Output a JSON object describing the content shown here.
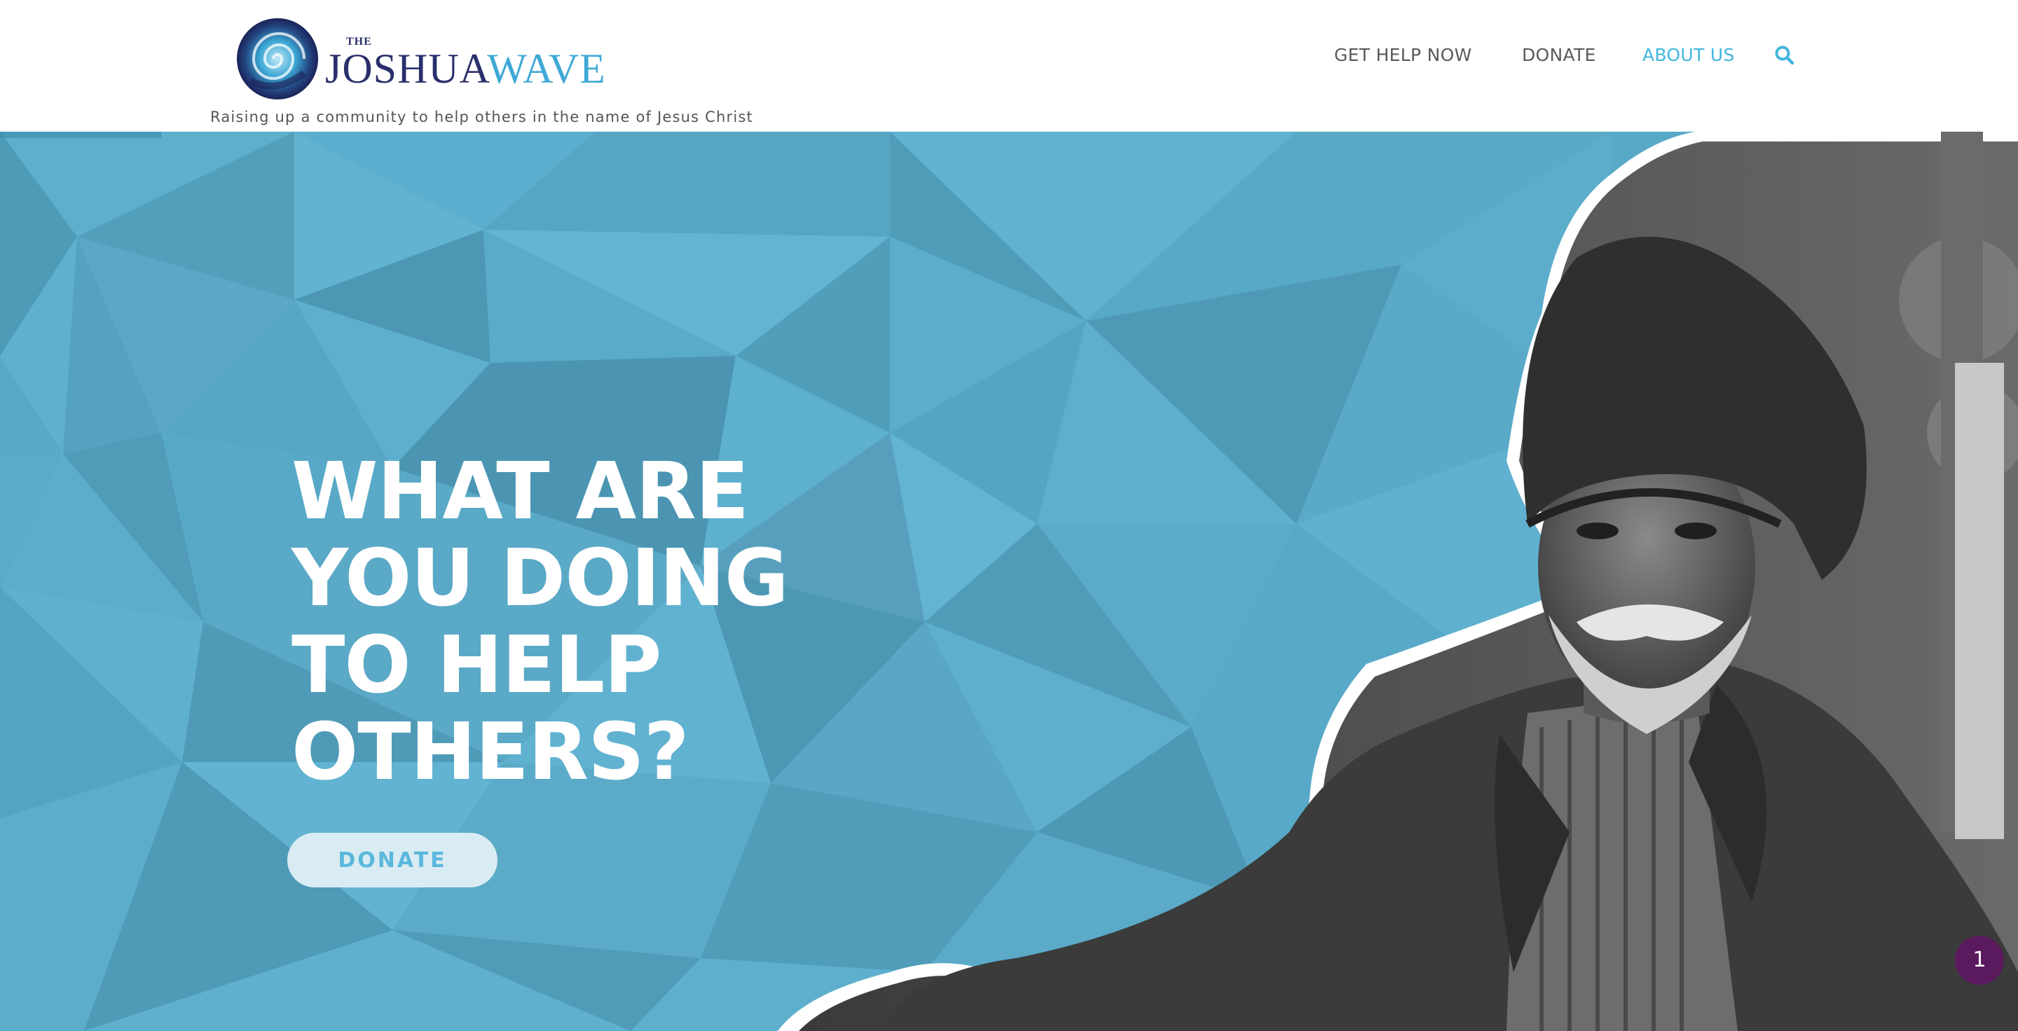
{
  "brand": {
    "the": "THE",
    "name_part1": "JOSHUA",
    "name_part2": "WAVE",
    "tagline": "Raising up a community to help others in the name of Jesus Christ"
  },
  "nav": {
    "items": [
      {
        "label": "GET HELP NOW",
        "active": false
      },
      {
        "label": "DONATE",
        "active": false
      },
      {
        "label": "ABOUT US",
        "active": true
      }
    ],
    "search_icon": "search-icon"
  },
  "hero": {
    "headline_lines": [
      "WHAT ARE",
      "YOU DOING",
      "TO HELP",
      "OTHERS?"
    ],
    "cta_label": "DONATE"
  },
  "notification": {
    "count": "1"
  },
  "colors": {
    "accent": "#41b6dd",
    "hero_background": "#58a9c7",
    "brand_navy": "#2a2f6b",
    "badge": "#5b1a5e",
    "button_background": "#d9ecf3"
  }
}
